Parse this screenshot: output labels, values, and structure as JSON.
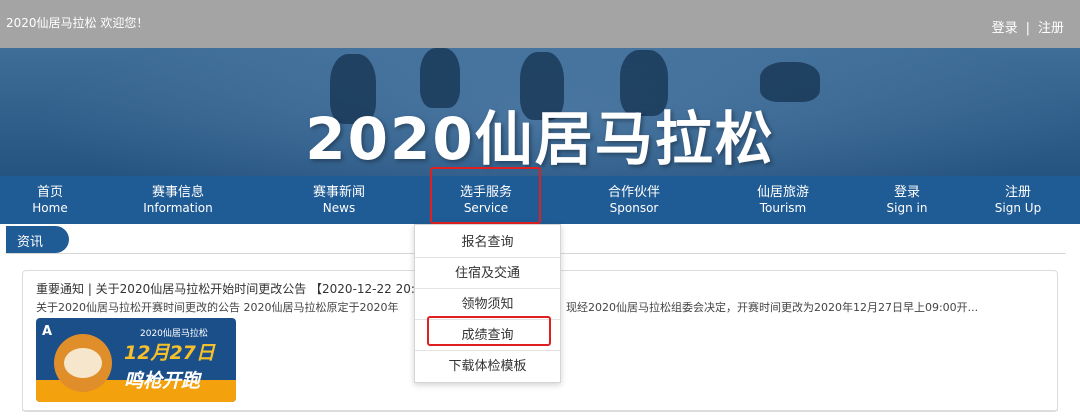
{
  "topbar": {
    "welcome": "2020仙居马拉松 欢迎您！",
    "login": "登录",
    "separator": "|",
    "register": "注册"
  },
  "hero": {
    "title": "2020仙居马拉松"
  },
  "nav": {
    "items": [
      {
        "zh": "首页",
        "en": "Home"
      },
      {
        "zh": "赛事信息",
        "en": "Information"
      },
      {
        "zh": "赛事新闻",
        "en": "News"
      },
      {
        "zh": "选手服务",
        "en": "Service"
      },
      {
        "zh": "合作伙伴",
        "en": "Sponsor"
      },
      {
        "zh": "仙居旅游",
        "en": "Tourism"
      },
      {
        "zh": "登录",
        "en": "Sign in"
      },
      {
        "zh": "注册",
        "en": "Sign Up"
      }
    ]
  },
  "service_dropdown": {
    "options": [
      "报名查询",
      "住宿及交通",
      "领物须知",
      "成绩查询",
      "下载体检模板"
    ]
  },
  "section": {
    "tab": "资讯"
  },
  "news": {
    "title": "重要通知 | 关于2020仙居马拉松开始时间更改公告 【2020-12-22 20:21",
    "summary_left": "关于2020仙居马拉松开赛时间更改的公告 2020仙居马拉松原定于2020年",
    "summary_right": "现经2020仙居马拉松组委会决定，开赛时间更改为2020年12月27日早上09:00开...",
    "poster": {
      "logo": "A",
      "subtitle": "2020仙居马拉松",
      "line1": "12月27日",
      "line2": "鸣枪开跑"
    }
  },
  "colors": {
    "nav_bg": "#1f5b95",
    "topbar_bg": "#a4a4a4",
    "highlight": "#e02020"
  }
}
